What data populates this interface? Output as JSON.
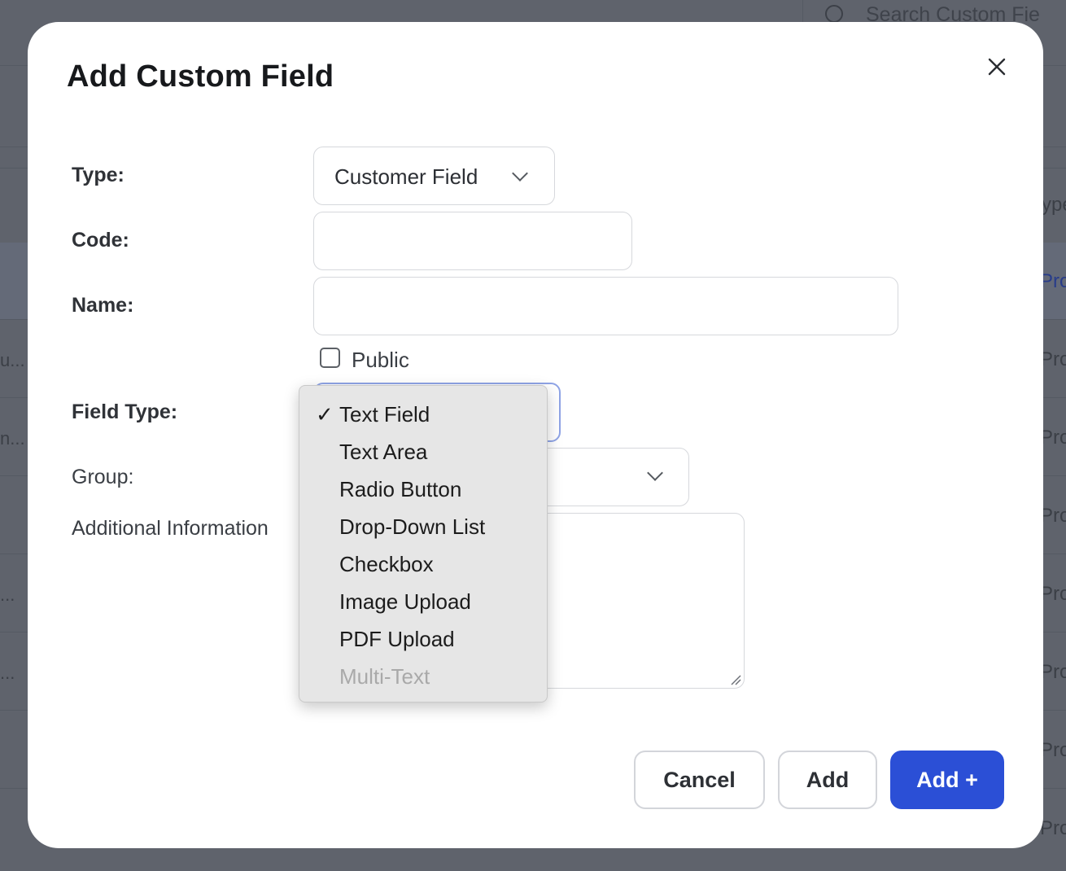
{
  "background": {
    "search_placeholder": "Search Custom Fie",
    "column_header": "ype",
    "rows_right": [
      "Pro",
      "Pro",
      "Pro",
      "Pro",
      "Pro",
      "Pro",
      "Pro",
      "Pro"
    ],
    "rows_left": [
      "u...",
      "n...",
      "...",
      "..."
    ]
  },
  "modal": {
    "title": "Add Custom Field",
    "labels": {
      "type": "Type:",
      "code": "Code:",
      "name": "Name:",
      "field_type": "Field Type:",
      "group": "Group:",
      "additional_info": "Additional Information"
    },
    "type_select": {
      "value": "Customer Field"
    },
    "code_input": {
      "value": ""
    },
    "name_input": {
      "value": ""
    },
    "public_checkbox": {
      "label": "Public",
      "checked": false
    },
    "field_type_dropdown": {
      "check_mark": "✓",
      "selected": "Text Field",
      "options": [
        {
          "label": "Text Field",
          "disabled": false
        },
        {
          "label": "Text Area",
          "disabled": false
        },
        {
          "label": "Radio Button",
          "disabled": false
        },
        {
          "label": "Drop-Down List",
          "disabled": false
        },
        {
          "label": "Checkbox",
          "disabled": false
        },
        {
          "label": "Image Upload",
          "disabled": false
        },
        {
          "label": "PDF Upload",
          "disabled": false
        },
        {
          "label": "Multi-Text",
          "disabled": true
        }
      ]
    },
    "buttons": {
      "cancel": "Cancel",
      "add": "Add",
      "add_plus": "Add +"
    }
  },
  "colors": {
    "primary": "#2b4fd6",
    "focus_border": "#8fa4e6",
    "overlay": "#5f636c"
  }
}
